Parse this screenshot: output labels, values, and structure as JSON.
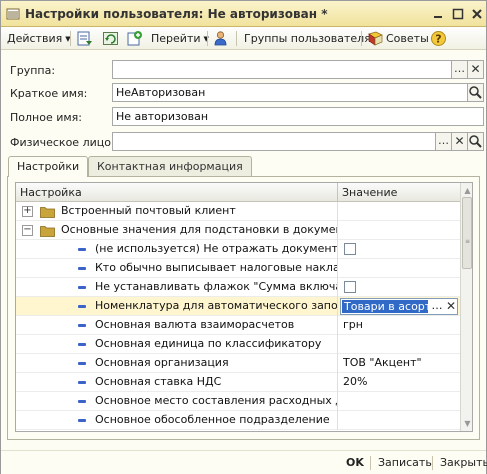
{
  "window": {
    "title": "Настройки пользователя: Не авторизован *"
  },
  "toolbar": {
    "actions_label": "Действия",
    "goto_label": "Перейти",
    "user_groups_label": "Группы пользователя",
    "tips_label": "Советы"
  },
  "form": {
    "group_label": "Группа:",
    "group_value": "",
    "short_name_label": "Краткое имя:",
    "short_name_value": "НеАвторизован",
    "full_name_label": "Полное имя:",
    "full_name_value": "Не авторизован",
    "person_label": "Физическое лицо:",
    "person_value": ""
  },
  "tabs": {
    "settings": "Настройки",
    "contact_info": "Контактная информация",
    "active": "settings"
  },
  "grid": {
    "col_setting": "Настройка",
    "col_value": "Значение",
    "rows": [
      {
        "type": "folder",
        "expander": "+",
        "label": "Встроенный почтовый клиент",
        "value": ""
      },
      {
        "type": "folder",
        "expander": "−",
        "label": "Основные значения для подстановки в документы ...",
        "value": ""
      },
      {
        "type": "item",
        "label": "(не используется) Не отражать документы в на...",
        "value": "",
        "checkbox": true
      },
      {
        "type": "item",
        "label": "Кто обычно выписывает налоговые накладные",
        "value": ""
      },
      {
        "type": "item",
        "label": "Не устанавливать флажок \"Сумма включает Н...",
        "value": "",
        "checkbox": true
      },
      {
        "type": "item",
        "label": "Номенклатура для автоматического заполнени...",
        "value": "Товари в асорті",
        "editing": true
      },
      {
        "type": "item",
        "label": "Основная валюта взаиморасчетов",
        "value": "грн"
      },
      {
        "type": "item",
        "label": "Основная единица по классификатору",
        "value": ""
      },
      {
        "type": "item",
        "label": "Основная организация",
        "value": "ТОВ \"Акцент\""
      },
      {
        "type": "item",
        "label": "Основная ставка НДС",
        "value": "20%"
      },
      {
        "type": "item",
        "label": "Основное место составления расходных докум...",
        "value": ""
      },
      {
        "type": "item",
        "label": "Основное обособленное подразделение",
        "value": ""
      }
    ]
  },
  "footer": {
    "ok_label": "OK",
    "save_label": "Записать",
    "close_label": "Закрыть"
  },
  "colors": {
    "title_bar": "#f1e29c",
    "selection": "#3169c6",
    "item_marker": "#3b63c9",
    "folder": "#c9a43a"
  }
}
